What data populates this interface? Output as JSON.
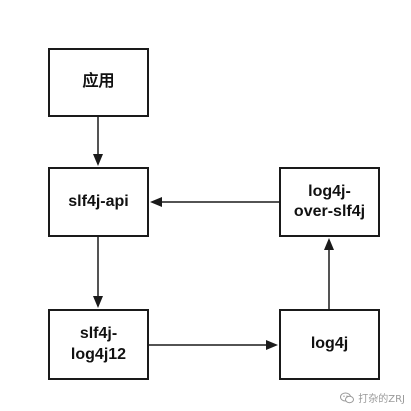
{
  "diagram": {
    "nodes": {
      "app": {
        "label": "应用"
      },
      "slf4j_api": {
        "label": "slf4j-api"
      },
      "log4j_over_slf4j": {
        "label": "log4j-\nover-slf4j"
      },
      "slf4j_log4j12": {
        "label": "slf4j-\nlog4j12"
      },
      "log4j": {
        "label": "log4j"
      }
    },
    "edges": [
      {
        "from": "app",
        "to": "slf4j_api"
      },
      {
        "from": "slf4j_api",
        "to": "slf4j_log4j12"
      },
      {
        "from": "slf4j_log4j12",
        "to": "log4j"
      },
      {
        "from": "log4j",
        "to": "log4j_over_slf4j"
      },
      {
        "from": "log4j_over_slf4j",
        "to": "slf4j_api"
      }
    ],
    "colors": {
      "stroke": "#1a1a1a",
      "text": "#111111",
      "background": "#ffffff",
      "watermark": "#9a9a9a"
    }
  },
  "watermark": {
    "icon": "wechat-icon",
    "text": "打杂的ZRJ"
  }
}
